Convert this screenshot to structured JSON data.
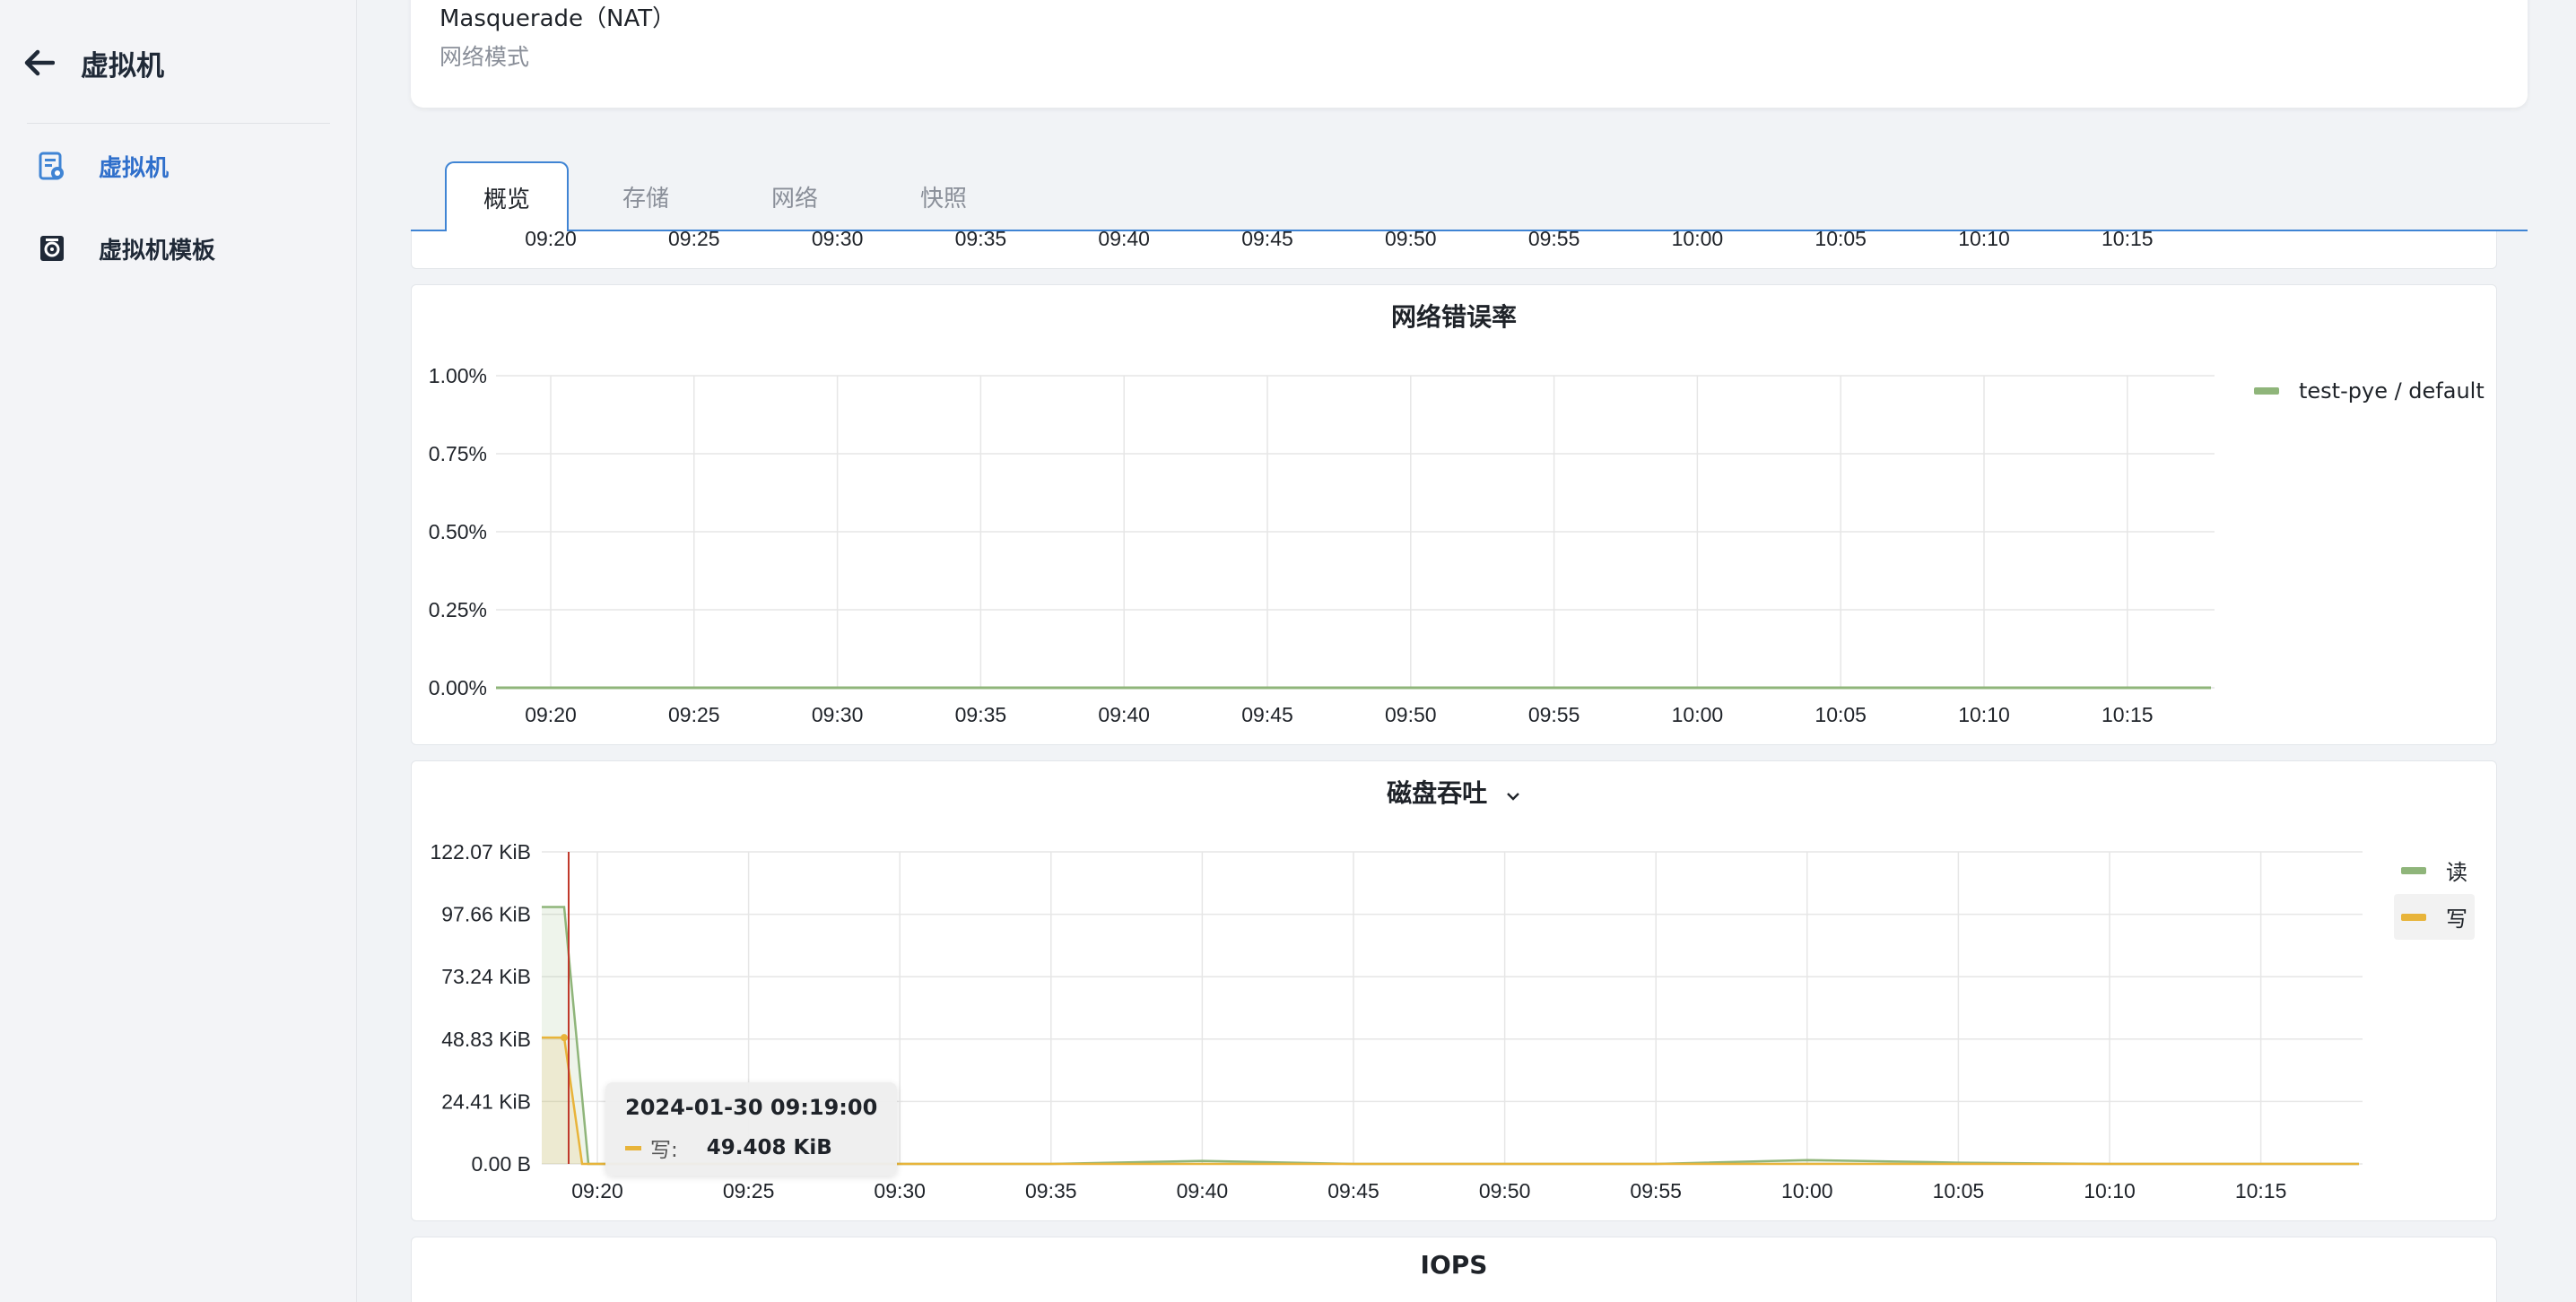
{
  "sidebar": {
    "title": "虚拟机",
    "items": [
      {
        "label": "虚拟机",
        "icon": "vm-icon",
        "active": true
      },
      {
        "label": "虚拟机模板",
        "icon": "vm-template-icon",
        "active": false
      }
    ]
  },
  "info": {
    "value": "Masquerade（NAT）",
    "label": "网络模式"
  },
  "tabs": [
    {
      "label": "概览",
      "active": true
    },
    {
      "label": "存储",
      "active": false
    },
    {
      "label": "网络",
      "active": false
    },
    {
      "label": "快照",
      "active": false
    }
  ],
  "time_ticks": [
    "09:20",
    "09:25",
    "09:30",
    "09:35",
    "09:40",
    "09:45",
    "09:50",
    "09:55",
    "10:00",
    "10:05",
    "10:10",
    "10:15"
  ],
  "colors": {
    "accent": "#3f84d4",
    "read": "#8fb57a",
    "write": "#e8b43a",
    "cursor": "#c0392b"
  },
  "iops_title": "IOPS",
  "chart_data": [
    {
      "type": "line",
      "title": "网络错误率",
      "x": [
        "09:20",
        "09:25",
        "09:30",
        "09:35",
        "09:40",
        "09:45",
        "09:50",
        "09:55",
        "10:00",
        "10:05",
        "10:10",
        "10:15"
      ],
      "yticks": [
        "0.00%",
        "0.25%",
        "0.50%",
        "0.75%",
        "1.00%"
      ],
      "ylim": [
        0,
        1.0
      ],
      "series": [
        {
          "name": "test-pye / default",
          "values": [
            0,
            0,
            0,
            0,
            0,
            0,
            0,
            0,
            0,
            0,
            0,
            0
          ]
        }
      ],
      "grid": true,
      "legend": "top-right"
    },
    {
      "type": "area",
      "title": "磁盘吞吐",
      "x": [
        "09:19",
        "09:20",
        "09:25",
        "09:30",
        "09:35",
        "09:40",
        "09:45",
        "09:50",
        "09:55",
        "10:00",
        "10:05",
        "10:10",
        "10:15"
      ],
      "xticks": [
        "09:20",
        "09:25",
        "09:30",
        "09:35",
        "09:40",
        "09:45",
        "09:50",
        "09:55",
        "10:00",
        "10:05",
        "10:10",
        "10:15"
      ],
      "yticks": [
        "0.00 B",
        "24.41 KiB",
        "48.83 KiB",
        "73.24 KiB",
        "97.66 KiB",
        "122.07 KiB"
      ],
      "ylim": [
        0,
        122.07
      ],
      "yunit": "KiB",
      "series": [
        {
          "name": "读",
          "values": [
            100.5,
            0,
            0,
            0,
            0,
            1.2,
            0,
            0,
            0,
            1.5,
            0.5,
            0,
            0
          ]
        },
        {
          "name": "写",
          "values": [
            49.408,
            0,
            0,
            0,
            0,
            0,
            0,
            0,
            0,
            0,
            0,
            0,
            0
          ]
        }
      ],
      "grid": true,
      "legend": "top-right",
      "tooltip": {
        "date": "2024-01-30 09:19:00",
        "series": "写:",
        "value": "49.408 KiB"
      }
    }
  ]
}
